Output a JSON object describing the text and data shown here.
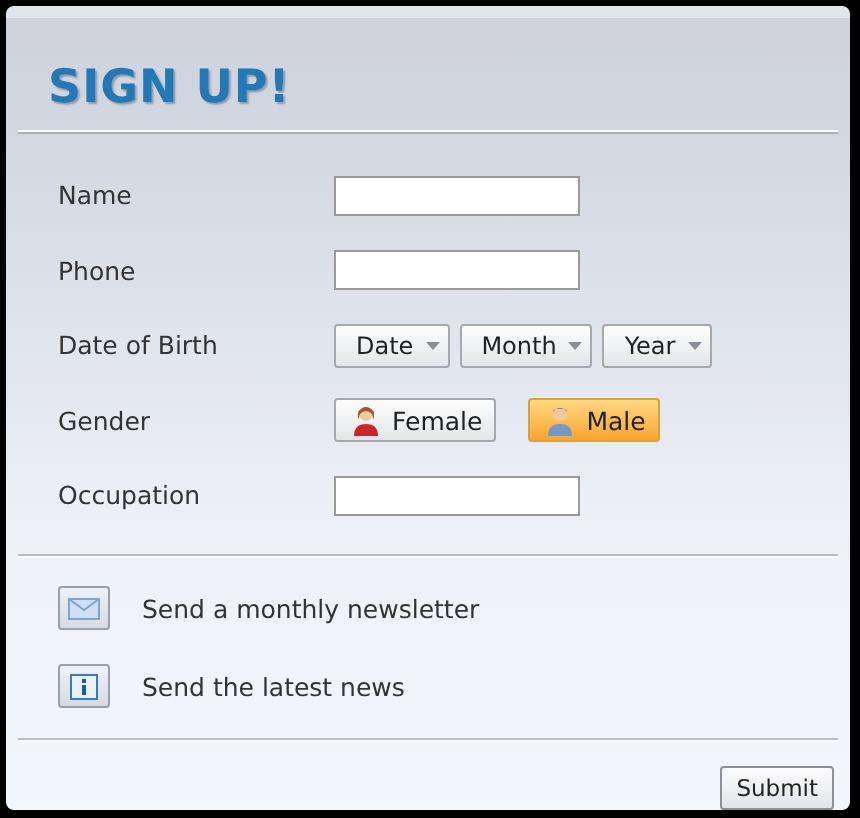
{
  "title": "SIGN UP!",
  "fields": [
    {
      "kind": "text",
      "label": "Name"
    },
    {
      "kind": "text",
      "label": "Phone"
    },
    {
      "kind": "dropdowns",
      "label": "Date of Birth",
      "dropdowns": [
        "Date",
        "Month",
        "Year"
      ]
    },
    {
      "kind": "choice",
      "label": "Gender",
      "options": [
        {
          "label": "Female",
          "selected": false
        },
        {
          "label": "Male",
          "selected": true
        }
      ]
    },
    {
      "kind": "text",
      "label": "Occupation"
    }
  ],
  "options": [
    {
      "label": "Send a monthly newsletter"
    },
    {
      "label": "Send the latest news"
    }
  ],
  "submit": "Submit"
}
